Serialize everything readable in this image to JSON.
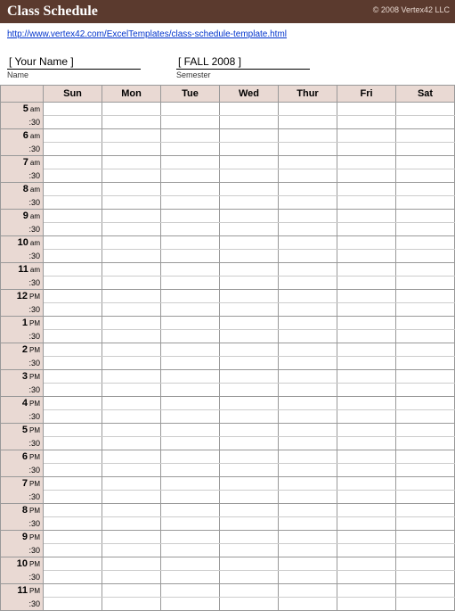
{
  "header": {
    "title": "Class Schedule",
    "copyright": "© 2008 Vertex42 LLC",
    "link": "http://www.vertex42.com/ExcelTemplates/class-schedule-template.html"
  },
  "info": {
    "name_value": "[  Your Name  ]",
    "name_label": "Name",
    "semester_value": "[  FALL 2008  ]",
    "semester_label": "Semester"
  },
  "days": [
    "Sun",
    "Mon",
    "Tue",
    "Wed",
    "Thur",
    "Fri",
    "Sat"
  ],
  "hours": [
    {
      "h": "5",
      "p": "am"
    },
    {
      "h": "6",
      "p": "am"
    },
    {
      "h": "7",
      "p": "am"
    },
    {
      "h": "8",
      "p": "am"
    },
    {
      "h": "9",
      "p": "am"
    },
    {
      "h": "10",
      "p": "am"
    },
    {
      "h": "11",
      "p": "am"
    },
    {
      "h": "12",
      "p": "PM"
    },
    {
      "h": "1",
      "p": "PM"
    },
    {
      "h": "2",
      "p": "PM"
    },
    {
      "h": "3",
      "p": "PM"
    },
    {
      "h": "4",
      "p": "PM"
    },
    {
      "h": "5",
      "p": "PM"
    },
    {
      "h": "6",
      "p": "PM"
    },
    {
      "h": "7",
      "p": "PM"
    },
    {
      "h": "8",
      "p": "PM"
    },
    {
      "h": "9",
      "p": "PM"
    },
    {
      "h": "10",
      "p": "PM"
    },
    {
      "h": "11",
      "p": "PM"
    }
  ],
  "half_label": ":30"
}
